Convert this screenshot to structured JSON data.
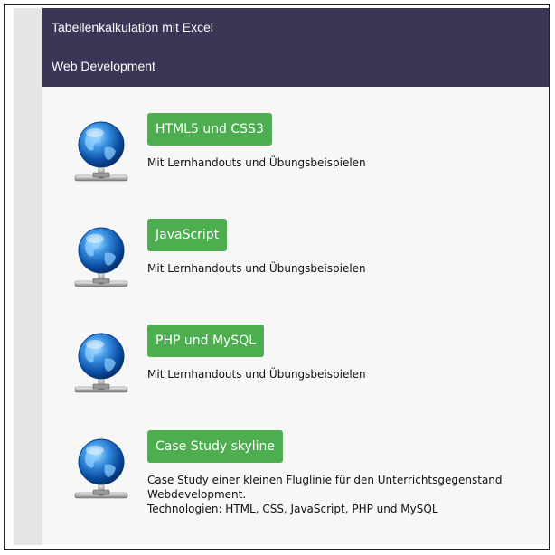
{
  "header": {
    "title": "Tabellenkalkulation mit Excel",
    "subtitle": "Web Development"
  },
  "courses": [
    {
      "label": "HTML5 und CSS3",
      "desc": [
        "Mit Lernhandouts und Übungsbeispielen"
      ]
    },
    {
      "label": "JavaScript",
      "desc": [
        "Mit Lernhandouts und Übungsbeispielen"
      ]
    },
    {
      "label": "PHP und MySQL",
      "desc": [
        "Mit Lernhandouts und Übungsbeispielen"
      ]
    },
    {
      "label": "Case Study skyline",
      "desc": [
        "Case Study einer kleinen Fluglinie für den Unterrichtsgegenstand",
        "Webdevelopment.",
        "Technologien: HTML, CSS, JavaScript, PHP und MySQL"
      ]
    }
  ],
  "colors": {
    "header_bg": "#3b3556",
    "button_bg": "#4cae4f",
    "page_bg": "#f7f7f7"
  },
  "icons": {
    "course_icon": "network-globe-icon"
  }
}
